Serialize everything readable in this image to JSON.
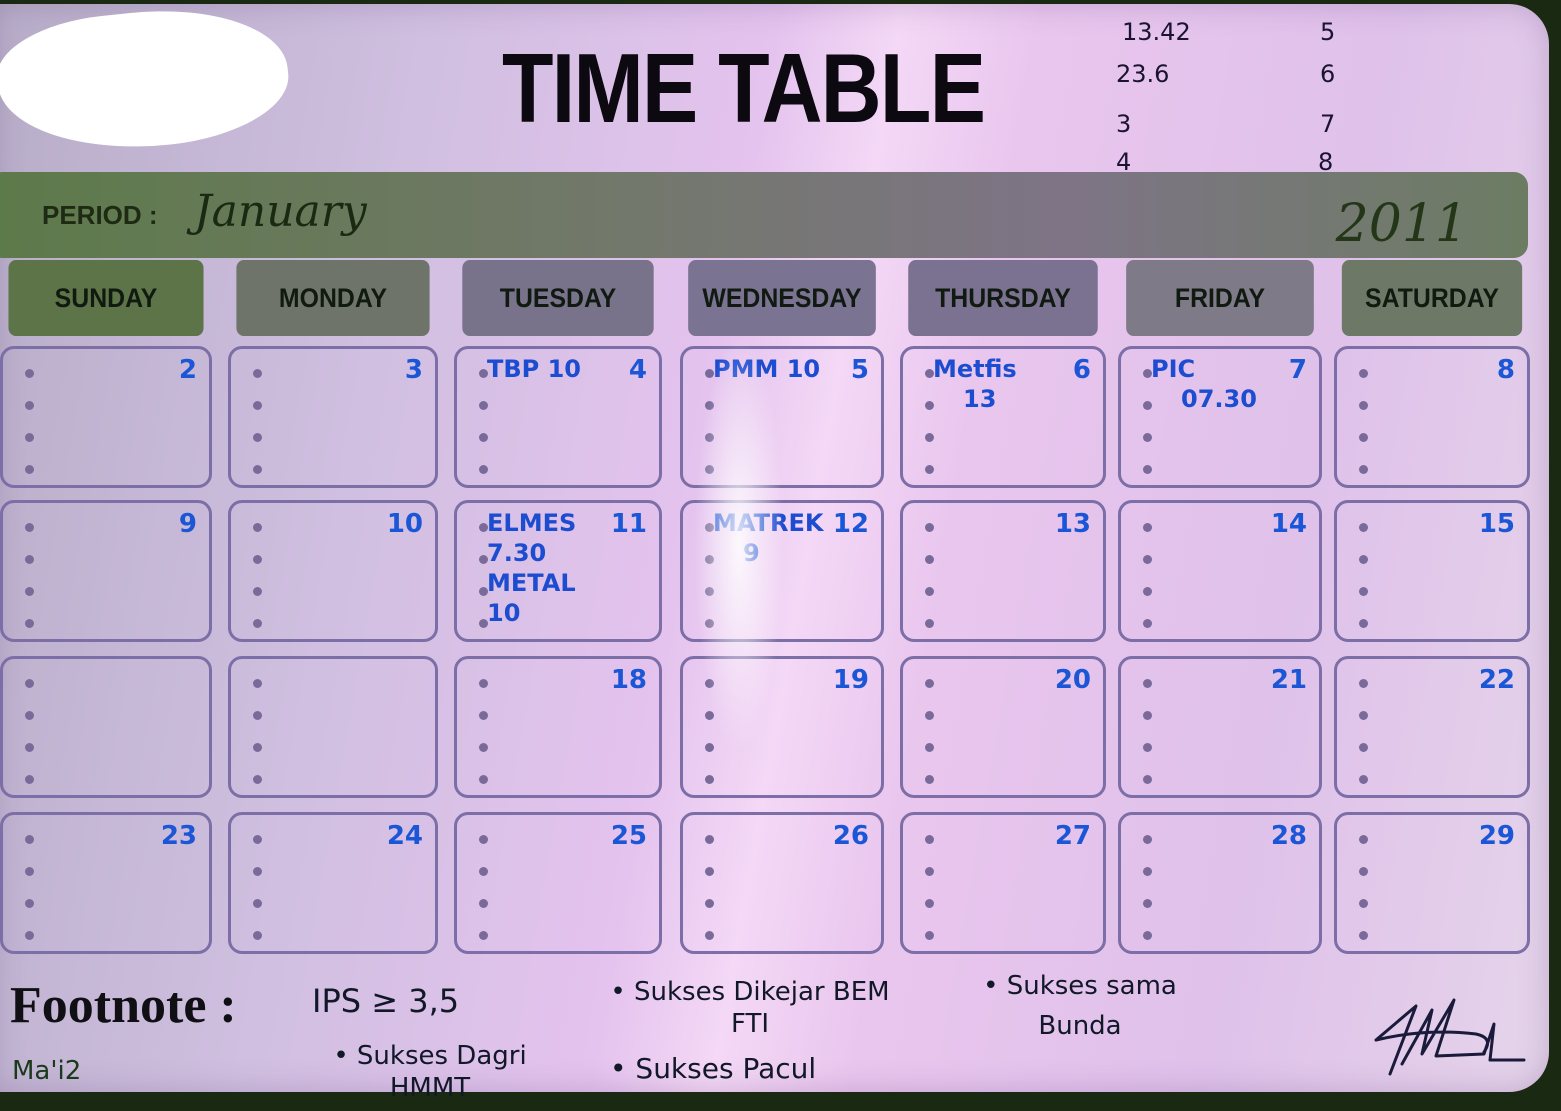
{
  "board": {
    "title": "TIME TABLE",
    "top_right_notes": {
      "left_column": [
        "13.42",
        "23.6",
        "3",
        "4"
      ],
      "right_column": [
        "5",
        "6",
        "7",
        "8"
      ]
    },
    "period": {
      "label": "PERIOD :",
      "month": "January",
      "year": "2011"
    },
    "weekdays": [
      "SUNDAY",
      "MONDAY",
      "TUESDAY",
      "WEDNESDAY",
      "THURSDAY",
      "FRIDAY",
      "SATURDAY"
    ],
    "weeks": [
      [
        {
          "day": "2",
          "entries": []
        },
        {
          "day": "3",
          "entries": []
        },
        {
          "day": "4",
          "entries": [
            "TBP 10"
          ]
        },
        {
          "day": "5",
          "entries": [
            "PMM 10"
          ]
        },
        {
          "day": "6",
          "entries": [
            "Metfis",
            "13"
          ]
        },
        {
          "day": "7",
          "entries": [
            "PIC",
            "07.30"
          ]
        },
        {
          "day": "8",
          "entries": []
        }
      ],
      [
        {
          "day": "9",
          "entries": []
        },
        {
          "day": "10",
          "entries": []
        },
        {
          "day": "11",
          "entries": [
            "ELMES",
            "7.30",
            "METAL",
            "10"
          ]
        },
        {
          "day": "12",
          "entries": [
            "MATREK",
            "9"
          ]
        },
        {
          "day": "13",
          "entries": []
        },
        {
          "day": "14",
          "entries": []
        },
        {
          "day": "15",
          "entries": []
        }
      ],
      [
        {
          "day": "",
          "entries": []
        },
        {
          "day": "",
          "entries": []
        },
        {
          "day": "18",
          "entries": []
        },
        {
          "day": "19",
          "entries": []
        },
        {
          "day": "20",
          "entries": []
        },
        {
          "day": "21",
          "entries": []
        },
        {
          "day": "22",
          "entries": []
        }
      ],
      [
        {
          "day": "23",
          "entries": []
        },
        {
          "day": "24",
          "entries": []
        },
        {
          "day": "25",
          "entries": []
        },
        {
          "day": "26",
          "entries": []
        },
        {
          "day": "27",
          "entries": []
        },
        {
          "day": "28",
          "entries": []
        },
        {
          "day": "29",
          "entries": []
        }
      ]
    ],
    "footnote": {
      "label": "Footnote :",
      "items": [
        "IPS ≥ 3,5",
        "• Sukses Dagri HMMT",
        "• Sukses Dikejar BEM FTI",
        "• Sukses Pacul",
        "• Sukses sama Bunda"
      ],
      "bottom_left": "Ma'i2"
    },
    "signature": "signature"
  }
}
